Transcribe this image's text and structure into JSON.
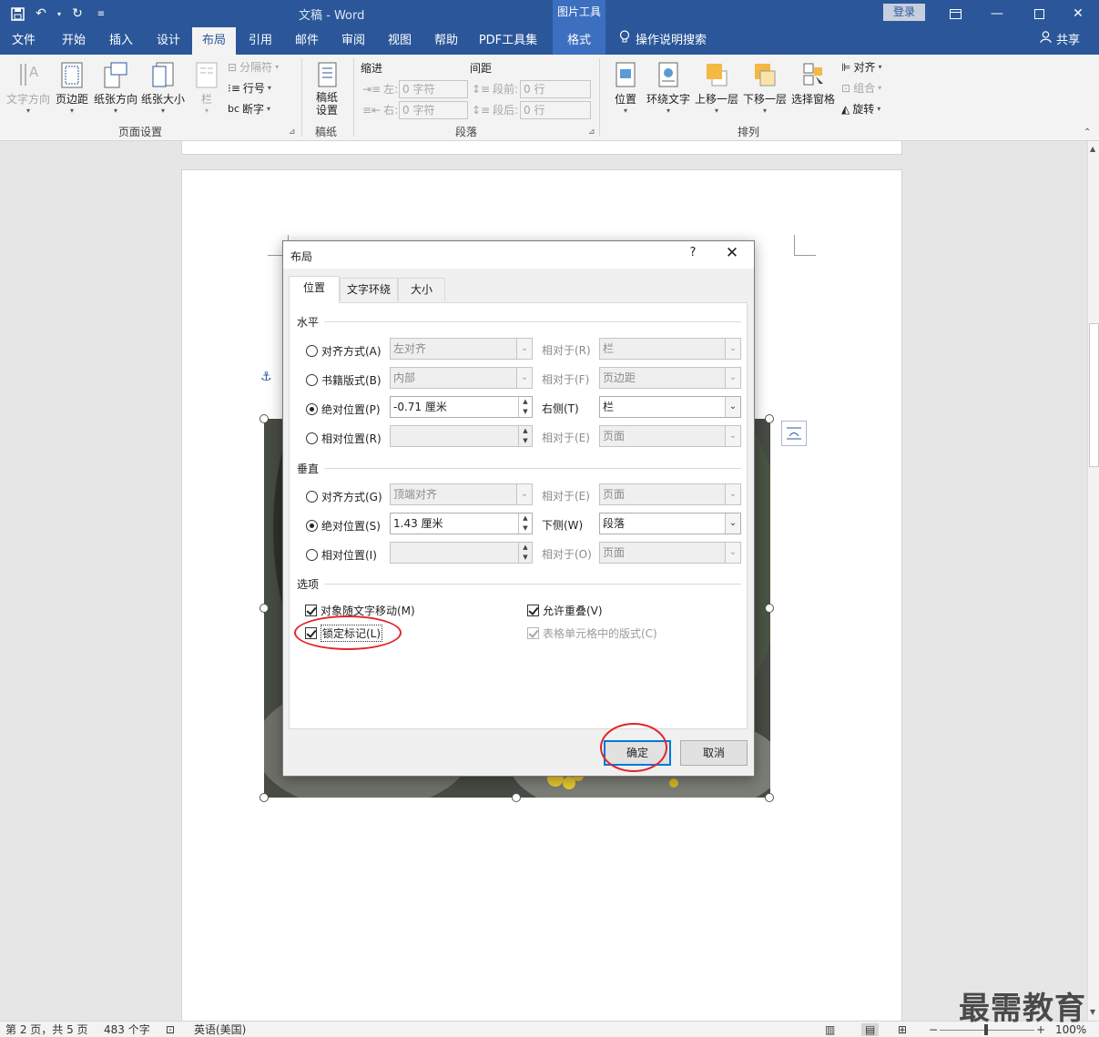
{
  "titlebar": {
    "doc_title": "文稿 - Word",
    "picture_tools": "图片工具",
    "login": "登录"
  },
  "tabs": [
    "文件",
    "开始",
    "插入",
    "设计",
    "布局",
    "引用",
    "邮件",
    "审阅",
    "视图",
    "帮助",
    "PDF工具集"
  ],
  "active_tab": "布局",
  "contextual_tab": "格式",
  "tell_me": "操作说明搜索",
  "share": "共享",
  "ribbon": {
    "text_direction": "文字方向",
    "margins": "页边距",
    "orientation": "纸张方向",
    "size": "纸张大小",
    "columns": "栏",
    "breaks": "分隔符",
    "line_numbers": "行号",
    "hyphenation": "断字",
    "page_setup_group": "页面设置",
    "manuscript": "稿纸设置",
    "manuscript_group": "稿纸",
    "indent_label": "缩进",
    "spacing_label": "间距",
    "indent_left_label": "左:",
    "indent_left_value": "0 字符",
    "indent_right_label": "右:",
    "indent_right_value": "0 字符",
    "space_before_label": "段前:",
    "space_before_value": "0 行",
    "space_after_label": "段后:",
    "space_after_value": "0 行",
    "paragraph_group": "段落",
    "position": "位置",
    "wrap_text": "环绕文字",
    "bring_forward": "上移一层",
    "send_backward": "下移一层",
    "selection_pane": "选择窗格",
    "align": "对齐",
    "group": "组合",
    "rotate": "旋转",
    "arrange_group": "排列"
  },
  "dialog": {
    "title": "布局",
    "help": "?",
    "tabs": [
      "位置",
      "文字环绕",
      "大小"
    ],
    "horizontal": "水平",
    "h_rows": [
      {
        "label": "对齐方式(A)",
        "value": "左对齐",
        "rel_label": "相对于(R)",
        "rel_value": "栏",
        "checked": false
      },
      {
        "label": "书籍版式(B)",
        "value": "内部",
        "rel_label": "相对于(F)",
        "rel_value": "页边距",
        "checked": false
      },
      {
        "label": "绝对位置(P)",
        "value": "-0.71 厘米",
        "rel_label": "右侧(T)",
        "rel_value": "栏",
        "checked": true
      },
      {
        "label": "相对位置(R)",
        "value": "",
        "rel_label": "相对于(E)",
        "rel_value": "页面",
        "checked": false
      }
    ],
    "vertical": "垂直",
    "v_rows": [
      {
        "label": "对齐方式(G)",
        "value": "顶端对齐",
        "rel_label": "相对于(E)",
        "rel_value": "页面",
        "checked": false
      },
      {
        "label": "绝对位置(S)",
        "value": "1.43 厘米",
        "rel_label": "下侧(W)",
        "rel_value": "段落",
        "checked": true
      },
      {
        "label": "相对位置(I)",
        "value": "",
        "rel_label": "相对于(O)",
        "rel_value": "页面",
        "checked": false
      }
    ],
    "options": "选项",
    "opt_move_with_text": "对象随文字移动(M)",
    "opt_lock_anchor": "锁定标记(L)",
    "opt_allow_overlap": "允许重叠(V)",
    "opt_table_cell": "表格单元格中的版式(C)",
    "ok": "确定",
    "cancel": "取消"
  },
  "status": {
    "page": "第 2 页，共 5 页",
    "words": "483 个字",
    "language": "英语(美国)",
    "zoom": "100%"
  },
  "watermark": "最需教育",
  "colors": {
    "brand": "#2b579a",
    "contextual": "#3c6fbf",
    "highlight_ring": "#e0262b"
  }
}
